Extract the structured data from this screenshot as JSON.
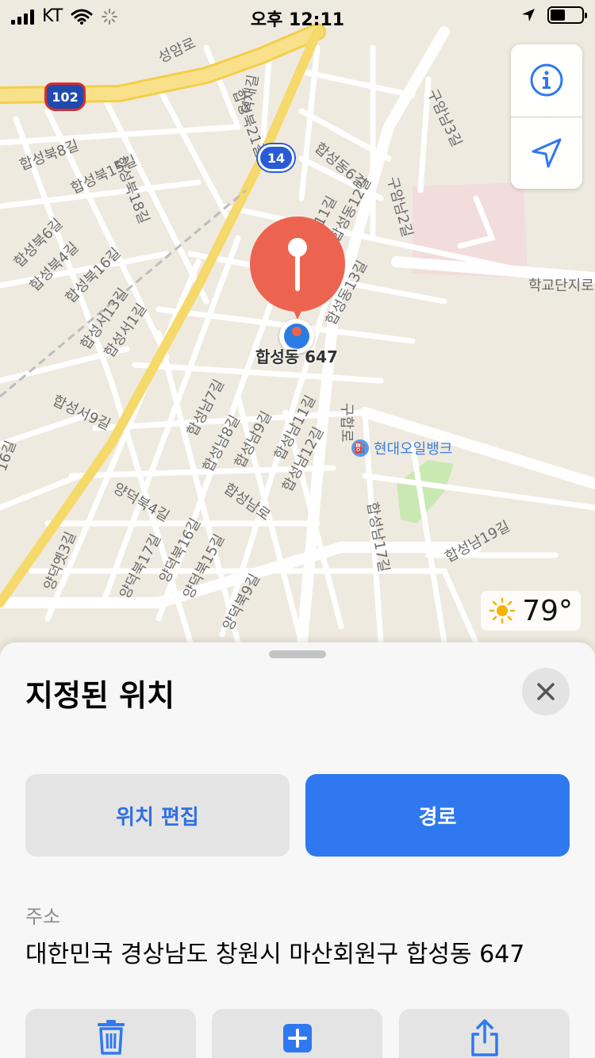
{
  "status_bar": {
    "carrier": "KT",
    "time": "오후 12:11"
  },
  "map": {
    "shields": {
      "us_route": "102",
      "local_route": "14"
    },
    "labels": [
      "성암로",
      "합성북21길",
      "덕재길",
      "합성동6길",
      "구암남3길",
      "구암남2길",
      "합성북8길",
      "합성북15길",
      "합성북18길",
      "합성북6길",
      "합성북4길",
      "합성북16길",
      "합성동12길",
      "합성동13길",
      "합성서13길",
      "합성서1길",
      "합성서9길",
      "합성남7길",
      "합성남8길",
      "합성남9길",
      "합성남11길",
      "합성남12길",
      "합성남로",
      "양덕북4길",
      "양덕북17길",
      "양덕북16길",
      "양덕북15길",
      "양덕북9길",
      "양덕옛3길",
      "합성남17길",
      "합성남19길",
      "학교단지로",
      "구합로",
      "11길",
      "16길"
    ],
    "pin_label": "합성동 647",
    "poi": {
      "icon": "fuel-icon",
      "name": "현대오일뱅크"
    },
    "weather": {
      "icon": "sun-icon",
      "temperature": "79°"
    },
    "controls": [
      "info-icon",
      "location-arrow-icon"
    ]
  },
  "sheet": {
    "title": "지정된 위치",
    "edit_label": "위치 편집",
    "route_label": "경로",
    "address_label": "주소",
    "address_value": "대한민국 경상남도 창원시 마산회원구 합성동 647",
    "bottom_actions": [
      "trash-icon",
      "add-icon",
      "share-icon"
    ]
  },
  "colors": {
    "accent": "#2f78f0",
    "pin": "#ec6450",
    "map_bg": "#efeae0",
    "highway": "#f7dc6f"
  }
}
